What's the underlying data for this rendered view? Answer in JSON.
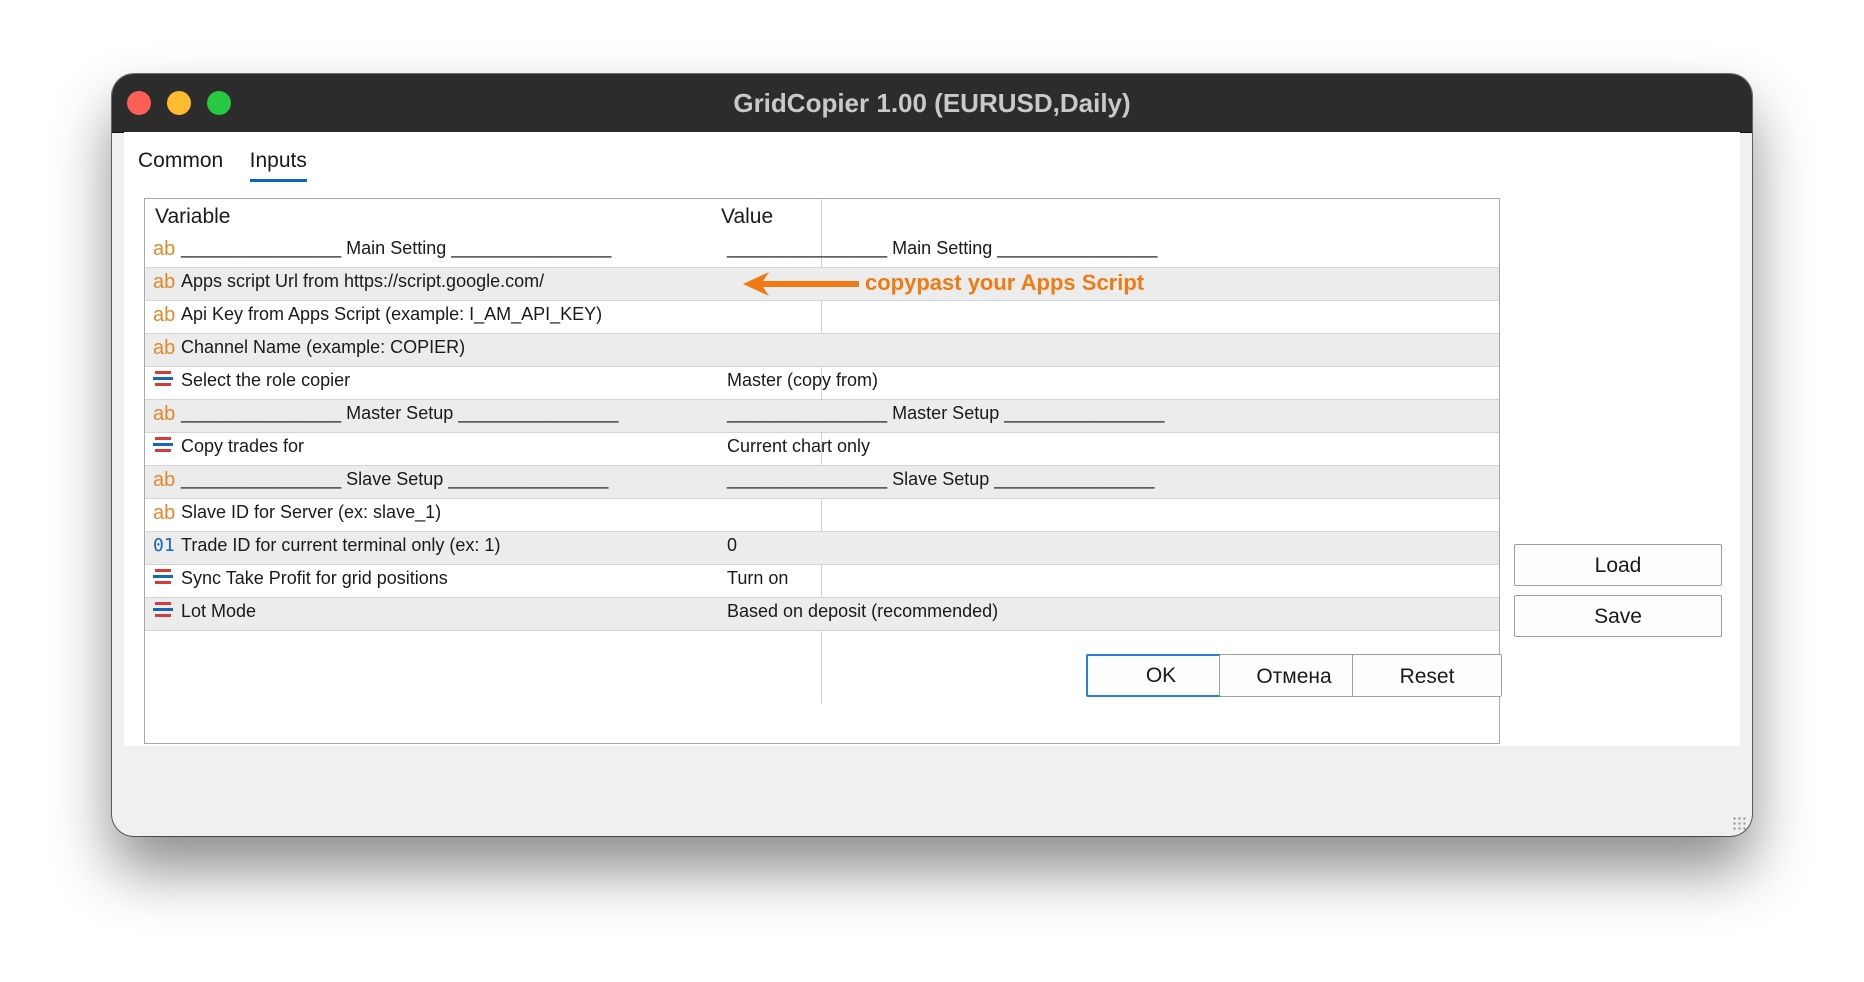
{
  "window": {
    "title": "GridCopier 1.00 (EURUSD,Daily)"
  },
  "tabs": [
    {
      "label": "Common",
      "active": false
    },
    {
      "label": "Inputs",
      "active": true
    }
  ],
  "grid": {
    "headers": {
      "variable": "Variable",
      "value": "Value"
    },
    "rows": [
      {
        "icon": "ab",
        "variable": "________________  Main Setting  ________________",
        "value": "________________  Main Setting  ________________"
      },
      {
        "icon": "ab",
        "variable": "Apps script Url from https://script.google.com/",
        "value": ""
      },
      {
        "icon": "ab",
        "variable": "Api Key from Apps Script (example: I_AM_API_KEY)",
        "value": ""
      },
      {
        "icon": "ab",
        "variable": "Channel Name (example: COPIER)",
        "value": ""
      },
      {
        "icon": "enum",
        "variable": "Select the role copier",
        "value": "Master (copy from)"
      },
      {
        "icon": "ab",
        "variable": "________________  Master Setup  ________________",
        "value": "________________  Master Setup  ________________"
      },
      {
        "icon": "enum",
        "variable": "Copy trades for",
        "value": "Current chart only"
      },
      {
        "icon": "ab",
        "variable": "________________  Slave Setup  ________________",
        "value": "________________  Slave Setup  ________________"
      },
      {
        "icon": "ab",
        "variable": "Slave ID for Server (ex: slave_1)",
        "value": ""
      },
      {
        "icon": "01",
        "variable": "Trade ID for current terminal only (ex: 1)",
        "value": "0"
      },
      {
        "icon": "enum",
        "variable": "Sync Take Profit for grid positions",
        "value": "Turn on"
      },
      {
        "icon": "enum",
        "variable": "Lot Mode",
        "value": "Based on deposit (recommended)"
      }
    ]
  },
  "annotation": {
    "text": "copypast your Apps Script",
    "color": "#f07a14"
  },
  "side_buttons": {
    "load": "Load",
    "save": "Save"
  },
  "footer_buttons": {
    "ok": "OK",
    "cancel": "Отмена",
    "reset": "Reset"
  },
  "colors": {
    "titlebar": "#2c2c2c",
    "tab_underline": "#0a64c8",
    "string_icon": "#e0872a",
    "int_icon": "#1767b5",
    "ok_border": "#2a7fd6"
  }
}
